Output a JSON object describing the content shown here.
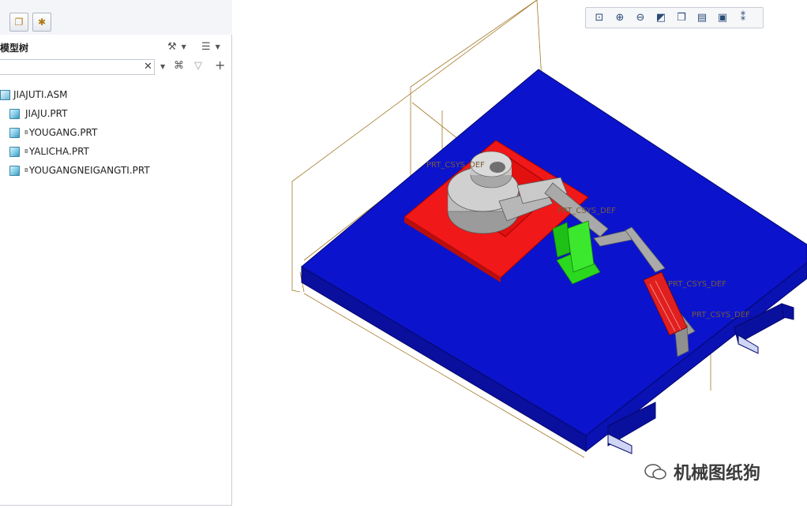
{
  "panel": {
    "title": "模型树",
    "search": {
      "value": "",
      "placeholder": ""
    }
  },
  "tree": {
    "root": {
      "label": "JIAJUTI.ASM"
    },
    "items": [
      {
        "label": "JIAJU.PRT",
        "flag": ""
      },
      {
        "label": "YOUGANG.PRT",
        "flag": "B"
      },
      {
        "label": "YALICHA.PRT",
        "flag": "B"
      },
      {
        "label": "YOUGANGNEIGANGTI.PRT",
        "flag": "B"
      }
    ]
  },
  "viewport": {
    "datum_labels": [
      "PRT_CSYS_DEF",
      "PRT_CSYS_DEF",
      "PRT_CSYS_DEF",
      "PRT_CSYS_DEF"
    ],
    "colors": {
      "base_plate": "#0a10c8",
      "fixture_base": "#f01818",
      "clamp_block": "#2bd81f",
      "cylinder": "#c8c8c8",
      "frame_lines": "#a57a2a"
    }
  },
  "view_toolbar": {
    "icons": [
      "refit-icon",
      "zoom-in-icon",
      "zoom-out-icon",
      "repaint-icon",
      "display-style-icon",
      "saved-views-icon",
      "view-manager-icon",
      "datum-display-icon"
    ]
  },
  "watermark": {
    "text": "机械图纸狗"
  }
}
